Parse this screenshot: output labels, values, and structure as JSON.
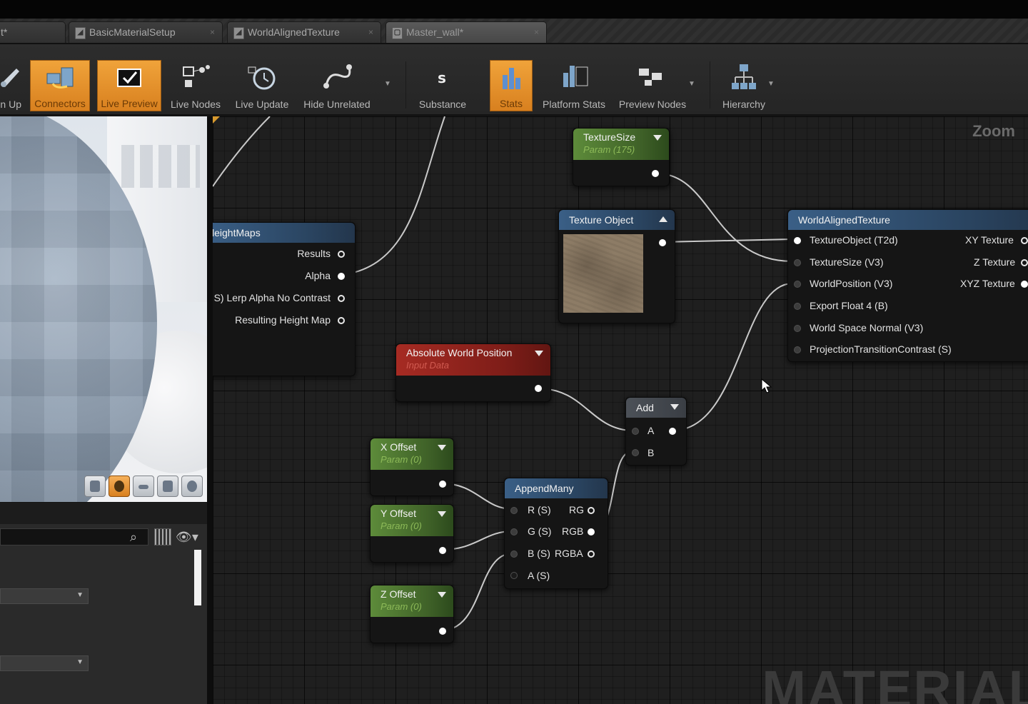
{
  "tabs": [
    {
      "label": "t*"
    },
    {
      "label": "BasicMaterialSetup"
    },
    {
      "label": "WorldAlignedTexture"
    },
    {
      "label": "Master_wall*"
    }
  ],
  "toolbar": {
    "buttons": [
      {
        "label": "n Up",
        "icon": "clean-up-icon",
        "active": false
      },
      {
        "label": "Connectors",
        "icon": "connectors-icon",
        "active": true
      },
      {
        "label": "Live Preview",
        "icon": "live-preview-icon",
        "active": true
      },
      {
        "label": "Live Nodes",
        "icon": "live-nodes-icon",
        "active": false
      },
      {
        "label": "Live Update",
        "icon": "live-update-icon",
        "active": false
      },
      {
        "label": "Hide Unrelated",
        "icon": "hide-unrelated-icon",
        "active": false
      },
      {
        "label": "Substance",
        "icon": "substance-icon",
        "active": false
      },
      {
        "label": "Stats",
        "icon": "stats-icon",
        "active": true
      },
      {
        "label": "Platform Stats",
        "icon": "platform-stats-icon",
        "active": false
      },
      {
        "label": "Preview Nodes",
        "icon": "preview-nodes-icon",
        "active": false
      },
      {
        "label": "Hierarchy",
        "icon": "hierarchy-icon",
        "active": false
      }
    ]
  },
  "graph": {
    "zoom_label": "Zoom",
    "watermark": "MATERIAL",
    "nodes": {
      "heightmaps": {
        "title": "leightMaps",
        "outputs": [
          "Results",
          "Alpha",
          "S) Lerp Alpha No Contrast",
          "Resulting Height Map"
        ]
      },
      "texture_size": {
        "title": "TextureSize",
        "subtitle": "Param (175)"
      },
      "texture_object": {
        "title": "Texture Object"
      },
      "world_aligned": {
        "title": "WorldAlignedTexture",
        "inputs": [
          "TextureObject (T2d)",
          "TextureSize (V3)",
          "WorldPosition (V3)",
          "Export Float 4 (B)",
          "World Space Normal (V3)",
          "ProjectionTransitionContrast (S)"
        ],
        "outputs": [
          "XY Texture",
          "Z Texture",
          "XYZ Texture"
        ]
      },
      "absolute_world_position": {
        "title": "Absolute World Position",
        "subtitle": "Input Data"
      },
      "add": {
        "title": "Add",
        "inputs": [
          "A",
          "B"
        ]
      },
      "x_offset": {
        "title": "X Offset",
        "subtitle": "Param (0)"
      },
      "y_offset": {
        "title": "Y Offset",
        "subtitle": "Param (0)"
      },
      "z_offset": {
        "title": "Z Offset",
        "subtitle": "Param (0)"
      },
      "append_many": {
        "title": "AppendMany",
        "inputs": [
          "R (S)",
          "G (S)",
          "B (S)",
          "A (S)"
        ],
        "outputs": [
          "RG",
          "RGB",
          "RGBA"
        ]
      }
    }
  },
  "colors": {
    "accent_orange": "#e8952d",
    "param_green": "#5d8b3a",
    "function_blue": "#3a5f86",
    "input_red": "#a62b23"
  }
}
